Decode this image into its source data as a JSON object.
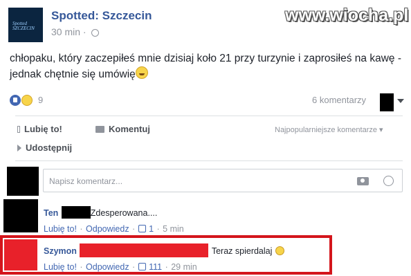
{
  "watermark": "www.wiocha.pl",
  "post": {
    "page_name": "Spotted: Szczecin",
    "avatar_text": "Spotted SZCZECIN",
    "time": "30 min",
    "text": "chłopaku, który zaczepiłeś mnie dzisiaj koło 21 przy turzynie i zaprosiłeś na kawę - jednak chętnie się umówię"
  },
  "reactions": {
    "count": "9",
    "comments": "6 komentarzy"
  },
  "actions": {
    "like": "Lubię to!",
    "comment": "Komentuj",
    "share": "Udostępnij",
    "sort": "Najpopularniejsze komentarze"
  },
  "composer": {
    "placeholder": "Napisz komentarz..."
  },
  "comments": [
    {
      "name": "Ten",
      "text": "Zdesperowana....",
      "like": "Lubię to!",
      "sep": "·",
      "reply": "Odpowiedz",
      "likes": "1",
      "time": "5 min"
    },
    {
      "name": "Szymon",
      "text": "Teraz spierdalaj",
      "like": "Lubię to!",
      "sep": "·",
      "reply": "Odpowiedz",
      "likes": "111",
      "time": "29 min"
    }
  ],
  "colors": {
    "link": "#365899",
    "redact": "#e8212a",
    "highlight": "#d4151c"
  }
}
